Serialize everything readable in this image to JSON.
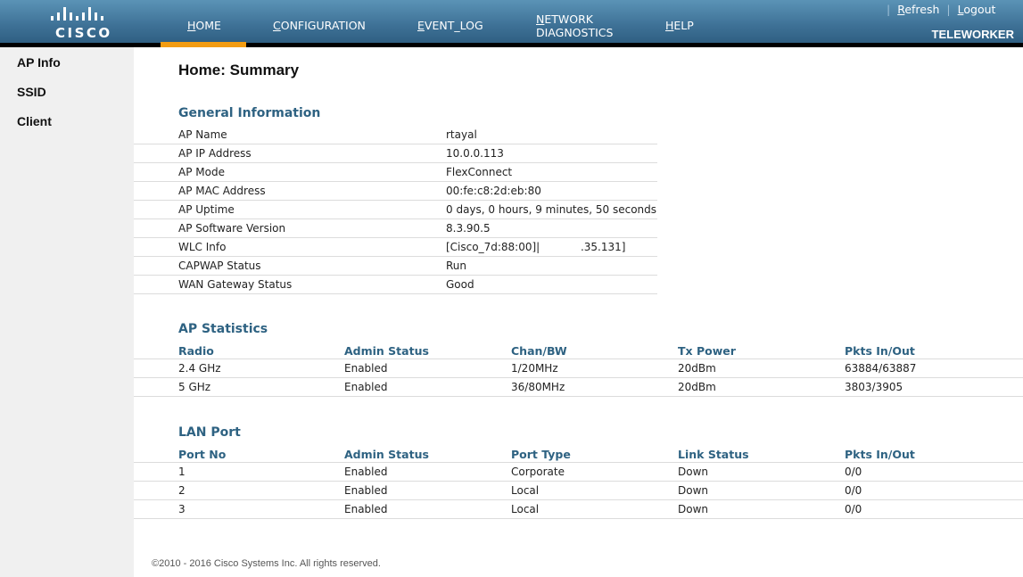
{
  "header": {
    "brand": "CISCO",
    "logo_icon": "cisco-bridge-logo",
    "nav": [
      {
        "accel": "H",
        "rest": "OME",
        "active": true
      },
      {
        "accel": "C",
        "rest": "ONFIGURATION",
        "active": false
      },
      {
        "accel": "E",
        "rest": "VENT_LOG",
        "active": false
      },
      {
        "accel": "N",
        "rest": "ETWORK",
        "line2": "DIAGNOSTICS",
        "active": false
      },
      {
        "accel": "H",
        "rest": "ELP",
        "active": false
      }
    ],
    "links": [
      {
        "accel": "R",
        "rest": "efresh"
      },
      {
        "accel": "L",
        "rest": "ogout"
      }
    ],
    "separator": "|",
    "mode": "TELEWORKER",
    "active_color": "#f39c12"
  },
  "sidebar": {
    "items": [
      {
        "label": "AP Info"
      },
      {
        "label": "SSID"
      },
      {
        "label": "Client"
      }
    ]
  },
  "main": {
    "title": "Home: Summary",
    "general": {
      "title": "General Information",
      "rows": [
        {
          "key": "AP Name",
          "value": "rtayal"
        },
        {
          "key": "AP IP Address",
          "value": "10.0.0.113"
        },
        {
          "key": "AP Mode",
          "value": "FlexConnect"
        },
        {
          "key": "AP MAC Address",
          "value": "00:fe:c8:2d:eb:80"
        },
        {
          "key": "AP Uptime",
          "value": "0 days, 0 hours, 9 minutes, 50 seconds"
        },
        {
          "key": "AP Software Version",
          "value": "8.3.90.5"
        },
        {
          "key": "WLC Info",
          "value": "[Cisco_7d:88:00]|            .35.131]"
        },
        {
          "key": "CAPWAP Status",
          "value": "Run"
        },
        {
          "key": "WAN Gateway Status",
          "value": "Good"
        }
      ]
    },
    "stats": {
      "title": "AP Statistics",
      "headers": [
        "Radio",
        "Admin Status",
        "Chan/BW",
        "Tx Power",
        "Pkts In/Out"
      ],
      "rows": [
        [
          "2.4 GHz",
          "Enabled",
          "1/20MHz",
          "20dBm",
          "63884/63887"
        ],
        [
          "5 GHz",
          "Enabled",
          "36/80MHz",
          "20dBm",
          "3803/3905"
        ]
      ]
    },
    "lan": {
      "title": "LAN Port",
      "headers": [
        "Port No",
        "Admin Status",
        "Port Type",
        "Link Status",
        "Pkts In/Out"
      ],
      "rows": [
        [
          "1",
          "Enabled",
          "Corporate",
          "Down",
          "0/0"
        ],
        [
          "2",
          "Enabled",
          "Local",
          "Down",
          "0/0"
        ],
        [
          "3",
          "Enabled",
          "Local",
          "Down",
          "0/0"
        ]
      ]
    },
    "footer": "©2010 - 2016 Cisco Systems Inc. All rights reserved."
  }
}
